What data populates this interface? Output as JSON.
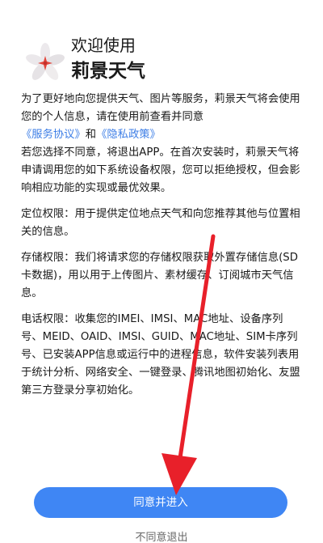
{
  "header": {
    "greeting": "欢迎使用",
    "app_name": "莉景天气",
    "logo_icon": "flower-logo-icon"
  },
  "intro": {
    "text": "为了更好地向您提供天气、图片等服务，莉景天气将会使用您的个人信息，请在使用前查看并同意",
    "service_link": "《服务协议》",
    "and_text": "和",
    "privacy_link": "《隐私政策》"
  },
  "paragraphs": [
    "若您选择不同意，将退出APP。在首次安装时，莉景天气将申请调用您的如下系统设备权限，您可以拒绝授权，但会影响相应功能的实现或最优效果。",
    "定位权限：用于提供定位地点天气和向您推荐其他与位置相关的信息。",
    "存储权限：我们将请求您的存储权限获取外置存储信息(SD卡数据)，用以用于上传图片、素材缓存、订阅城市天气信息。",
    "电话权限：收集您的IMEI、IMSI、MAC地址、设备序列号、MEID、OAID、IMSI、GUID、MAC地址、SIM卡序列号、已安装APP信息或运行中的进程信息，软件安装列表用于统计分析、网络安全、一键登录、腾讯地图初始化、友盟第三方登录分享初始化。"
  ],
  "buttons": {
    "agree_label": "同意并进入",
    "disagree_label": "不同意退出"
  },
  "colors": {
    "accent": "#3f86f4",
    "link": "#3d7ee6",
    "annotation_arrow": "#e8202a"
  }
}
